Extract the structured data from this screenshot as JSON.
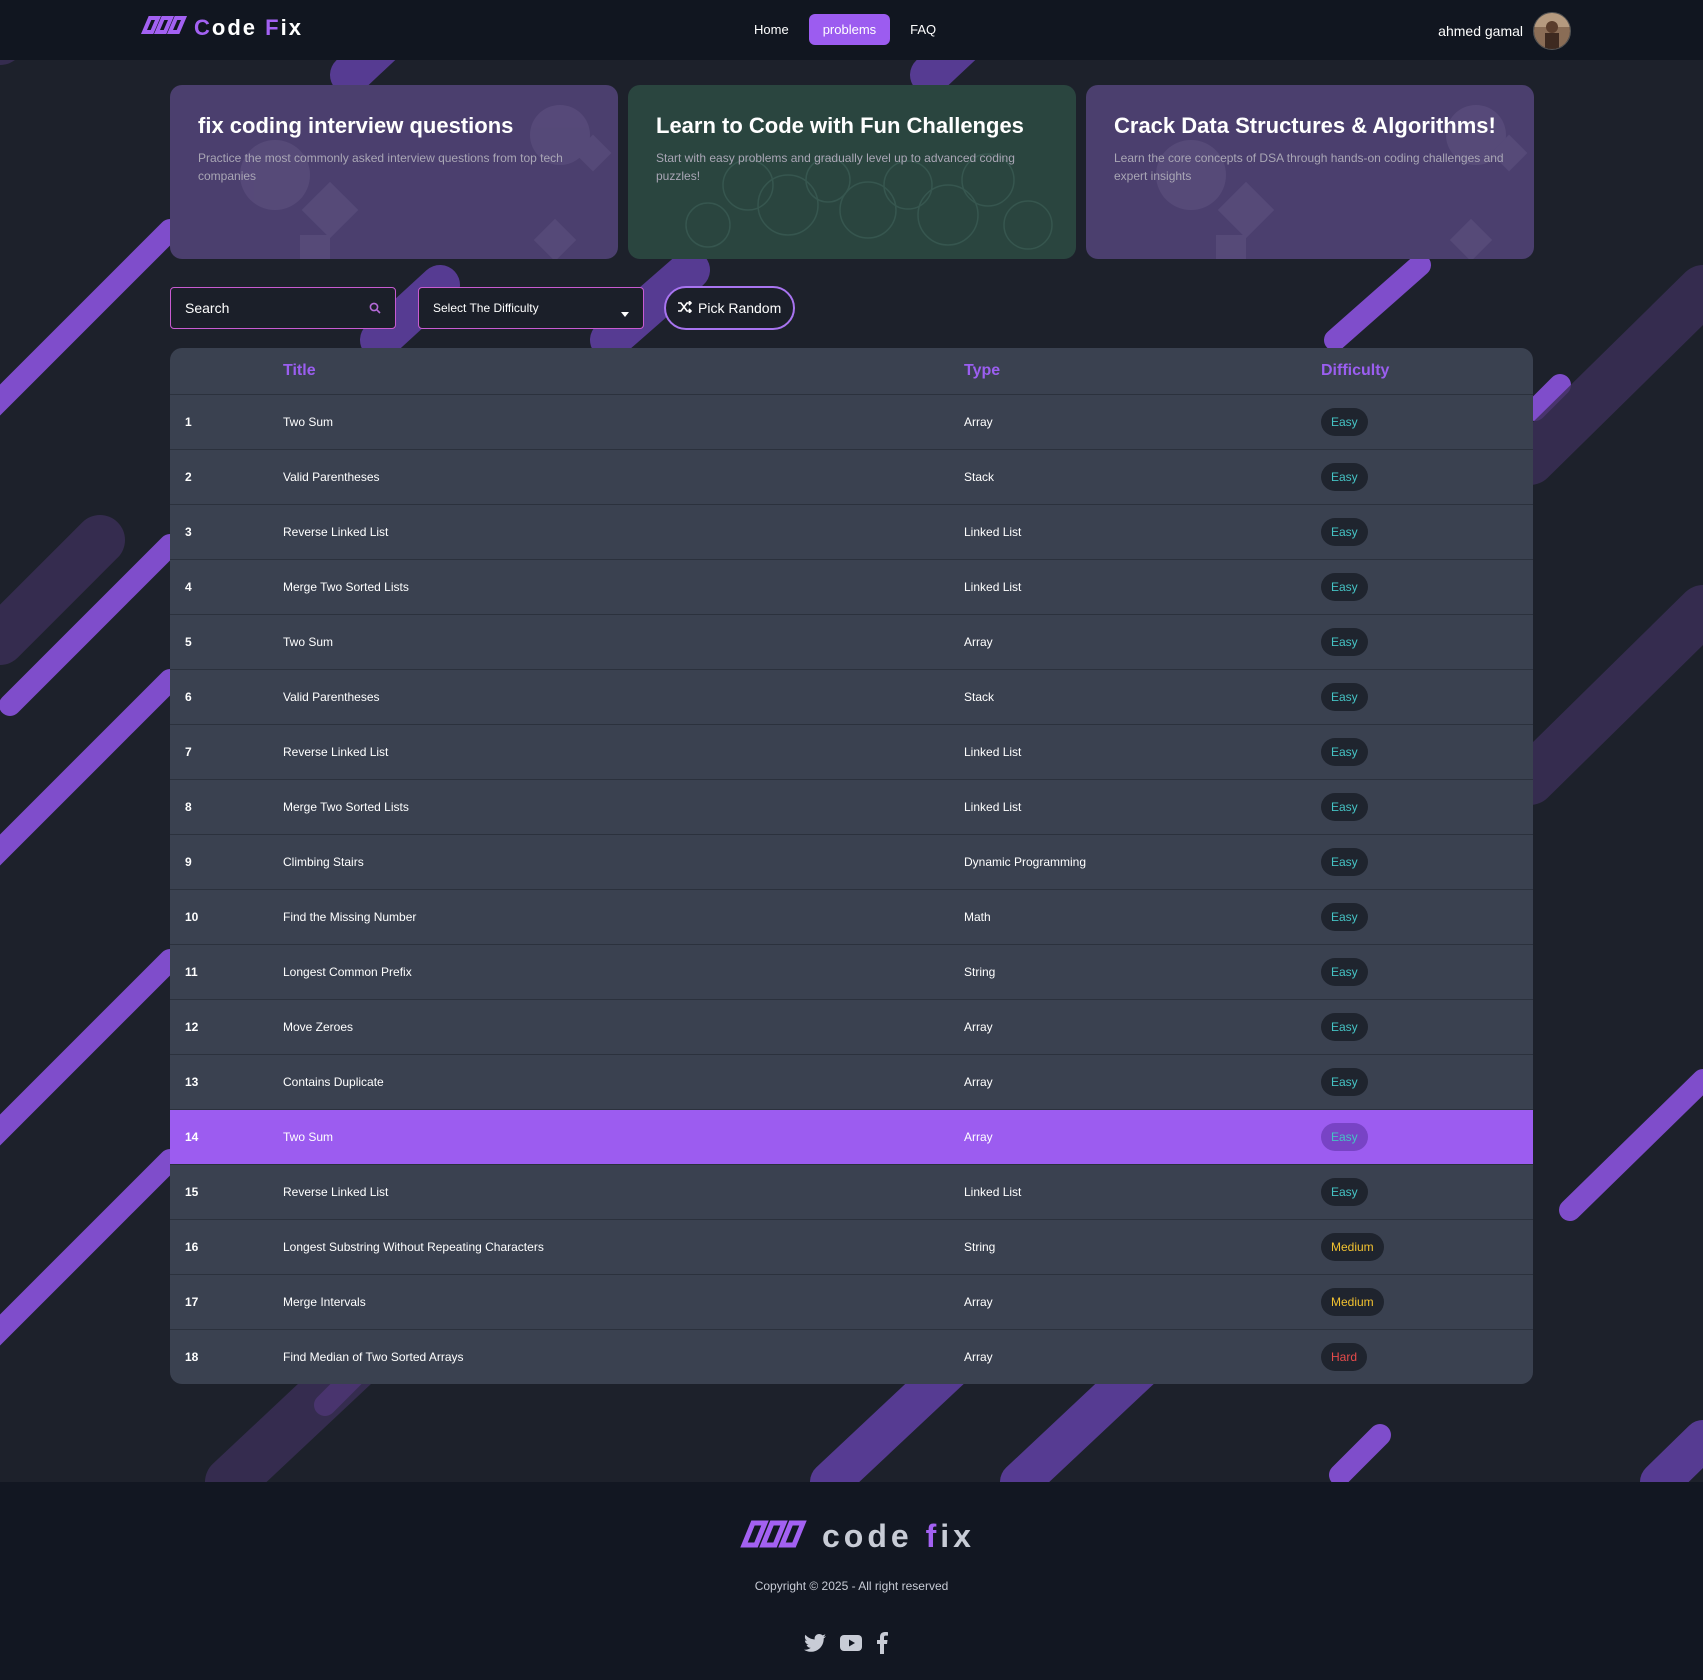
{
  "brand": {
    "name_c": "C",
    "name_ode": "ode ",
    "name_f": "F",
    "name_ix": "ix"
  },
  "nav": {
    "home": "Home",
    "problems": "problems",
    "faq": "FAQ"
  },
  "user": {
    "name": "ahmed gamal"
  },
  "cards": [
    {
      "title": "fix coding interview questions",
      "text": "Practice the most commonly asked interview questions from top tech companies"
    },
    {
      "title": "Learn to Code with Fun Challenges",
      "text": "Start with easy problems and gradually level up to advanced coding puzzles!"
    },
    {
      "title": "Crack Data Structures & Algorithms!",
      "text": "Learn the core concepts of DSA through hands-on coding challenges and expert insights"
    }
  ],
  "search": {
    "placeholder": "Search",
    "value": ""
  },
  "difficulty_select": {
    "label": "Select The Difficulty"
  },
  "pick_random": {
    "label": "Pick Random"
  },
  "table": {
    "headers": {
      "number": "",
      "title": "Title",
      "type": "Type",
      "difficulty": "Difficulty"
    },
    "rows": [
      {
        "n": "1",
        "title": "Two Sum",
        "type": "Array",
        "difficulty": "Easy"
      },
      {
        "n": "2",
        "title": "Valid Parentheses",
        "type": "Stack",
        "difficulty": "Easy"
      },
      {
        "n": "3",
        "title": "Reverse Linked List",
        "type": "Linked List",
        "difficulty": "Easy"
      },
      {
        "n": "4",
        "title": "Merge Two Sorted Lists",
        "type": "Linked List",
        "difficulty": "Easy"
      },
      {
        "n": "5",
        "title": "Two Sum",
        "type": "Array",
        "difficulty": "Easy"
      },
      {
        "n": "6",
        "title": "Valid Parentheses",
        "type": "Stack",
        "difficulty": "Easy"
      },
      {
        "n": "7",
        "title": "Reverse Linked List",
        "type": "Linked List",
        "difficulty": "Easy"
      },
      {
        "n": "8",
        "title": "Merge Two Sorted Lists",
        "type": "Linked List",
        "difficulty": "Easy"
      },
      {
        "n": "9",
        "title": "Climbing Stairs",
        "type": "Dynamic Programming",
        "difficulty": "Easy"
      },
      {
        "n": "10",
        "title": "Find the Missing Number",
        "type": "Math",
        "difficulty": "Easy"
      },
      {
        "n": "11",
        "title": "Longest Common Prefix",
        "type": "String",
        "difficulty": "Easy"
      },
      {
        "n": "12",
        "title": "Move Zeroes",
        "type": "Array",
        "difficulty": "Easy"
      },
      {
        "n": "13",
        "title": "Contains Duplicate",
        "type": "Array",
        "difficulty": "Easy"
      },
      {
        "n": "14",
        "title": "Two Sum",
        "type": "Array",
        "difficulty": "Easy"
      },
      {
        "n": "15",
        "title": "Reverse Linked List",
        "type": "Linked List",
        "difficulty": "Easy"
      },
      {
        "n": "16",
        "title": "Longest Substring Without Repeating Characters",
        "type": "String",
        "difficulty": "Medium"
      },
      {
        "n": "17",
        "title": "Merge Intervals",
        "type": "Array",
        "difficulty": "Medium"
      },
      {
        "n": "18",
        "title": "Find Median of Two Sorted Arrays",
        "type": "Array",
        "difficulty": "Hard"
      }
    ]
  },
  "footer": {
    "brand_code": "code ",
    "brand_f": "f",
    "brand_ix": "ix",
    "copyright": "Copyright © 2025 - All right reserved"
  },
  "icons": {
    "logo": "infinity-logo-icon",
    "search": "search-icon",
    "caret": "caret-down-icon",
    "shuffle": "shuffle-icon",
    "twitter": "twitter-icon",
    "youtube": "youtube-icon",
    "facebook": "facebook-icon"
  },
  "colors": {
    "accent": "#9c5cf0",
    "easy": "#45c3c4",
    "medium": "#f2c230",
    "hard": "#e74b4b"
  }
}
